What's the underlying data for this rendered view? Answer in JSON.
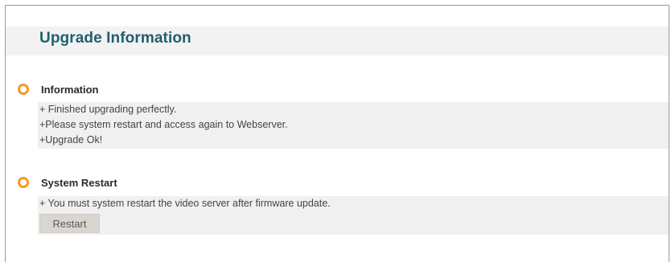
{
  "header": {
    "title": "Upgrade Information"
  },
  "sections": {
    "information": {
      "title": "Information",
      "lines": [
        "+ Finished upgrading perfectly.",
        "+Please system restart and access again to Webserver.",
        "+Upgrade Ok!"
      ]
    },
    "system_restart": {
      "title": "System Restart",
      "lines": [
        "+ You must system restart the video server after firmware update."
      ],
      "button_label": "Restart"
    }
  },
  "colors": {
    "title": "#1f5f6f",
    "bullet": "#f59a23",
    "panel_bg": "#f0f0f0"
  },
  "icons": {
    "section_bullet": "circle-bullet-icon"
  }
}
